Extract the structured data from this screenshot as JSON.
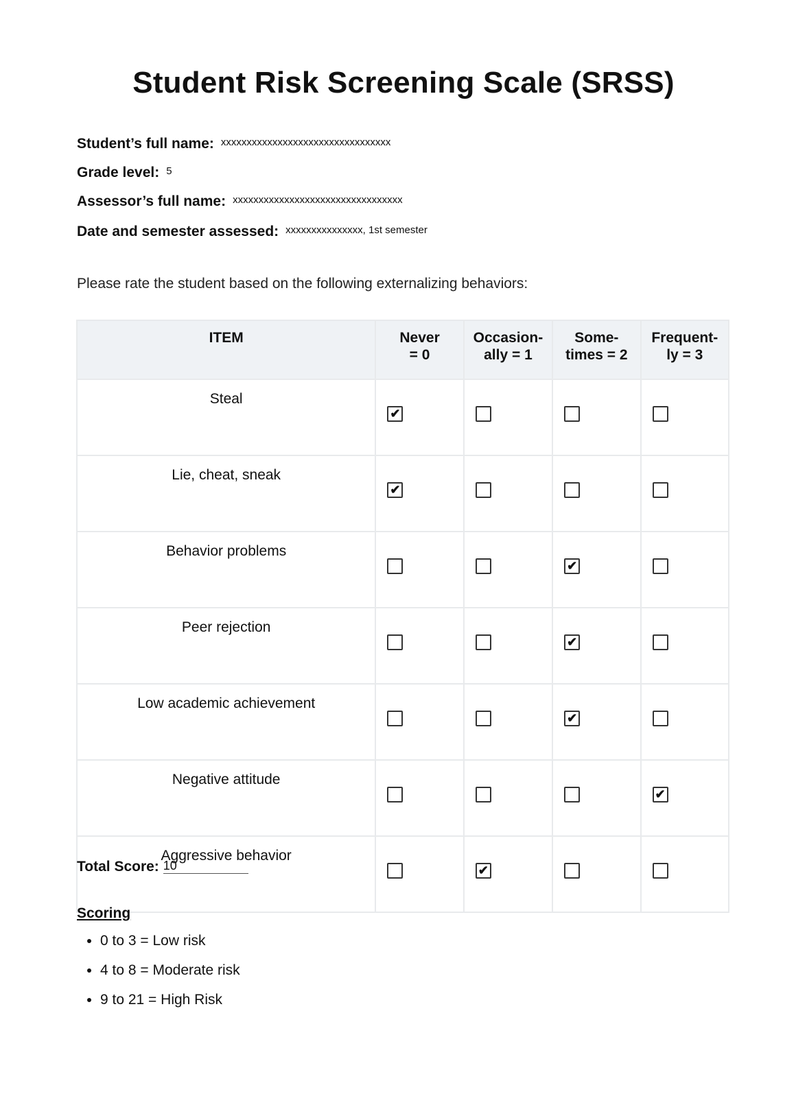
{
  "title": "Student Risk Screening Scale (SRSS)",
  "fields": [
    {
      "label": "Student’s full name:",
      "value": "xxxxxxxxxxxxxxxxxxxxxxxxxxxxxxxxx"
    },
    {
      "label": "Grade level:",
      "value": "5"
    },
    {
      "label": "Assessor’s full name:",
      "value": "xxxxxxxxxxxxxxxxxxxxxxxxxxxxxxxxx"
    },
    {
      "label": "Date and semester assessed:",
      "value": "xxxxxxxxxxxxxxx, 1st semester"
    }
  ],
  "intro": "Please rate the student based on the following externalizing behaviors:",
  "table": {
    "headers": [
      "ITEM",
      "Never\n= 0",
      "Occasion-\nally = 1",
      "Some-\ntimes = 2",
      "Frequent-\nly = 3"
    ],
    "rows": [
      {
        "item": "Steal",
        "checked": 0
      },
      {
        "item": "Lie, cheat, sneak",
        "checked": 0
      },
      {
        "item": "Behavior problems",
        "checked": 2
      },
      {
        "item": "Peer rejection",
        "checked": 2
      },
      {
        "item": "Low academic achievement",
        "checked": 2
      },
      {
        "item": "Negative attitude",
        "checked": 3
      },
      {
        "item": "Aggressive behavior",
        "checked": 1
      }
    ],
    "check_glyph": "✔"
  },
  "total": {
    "label": "Total Score:",
    "value": "10"
  },
  "scoring": {
    "heading": "Scoring",
    "items": [
      "0 to 3 = Low risk",
      "4 to 8 = Moderate risk",
      "9 to 21 = High Risk"
    ]
  }
}
